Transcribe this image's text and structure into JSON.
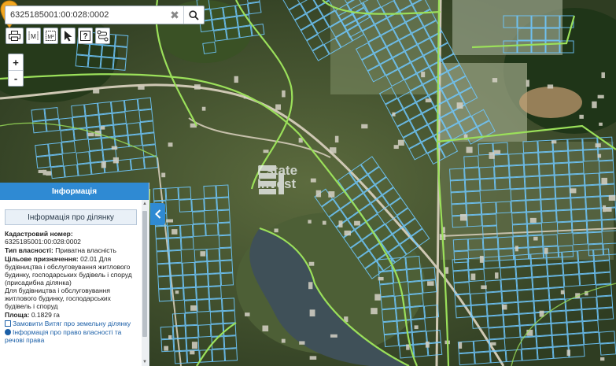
{
  "search": {
    "value": "6325185001:00:028:0002",
    "placeholder": ""
  },
  "toolbar": {
    "tools": [
      {
        "icon": "printer-icon"
      },
      {
        "icon": "measure-distance-icon",
        "label": "M"
      },
      {
        "icon": "measure-area-icon",
        "label": "M²"
      },
      {
        "icon": "cursor-icon"
      },
      {
        "icon": "help-icon",
        "label": "?"
      },
      {
        "icon": "route-icon"
      }
    ]
  },
  "zoom": {
    "in_label": "+",
    "out_label": "-"
  },
  "watermark": {
    "line1": "Estate",
    "line2": "Invest"
  },
  "panel": {
    "header": "Інформація",
    "section_title": "Інформація про ділянку",
    "cadastral_label": "Кадастровий номер:",
    "cadastral_value": "6325185001:00:028:0002",
    "ownership_label": "Тип власності:",
    "ownership_value": "Приватна власність",
    "purpose_label": "Цільове призначення:",
    "purpose_value": "02.01 Для будівництва і обслуговування житлового будинку, господарських будівель і споруд (присадибна ділянка)",
    "purpose_extra": "Для будівництва і обслуговування житлового будинку, господарських будівель і споруд",
    "area_label": "Площа:",
    "area_value": "0.1829 га",
    "link_extract": "Замовити Витяг про земельну ділянку",
    "link_rights": "Інформація про право власності та речові права"
  },
  "colors": {
    "accent": "#2f8ad3",
    "parcel_outline": "#6fc8ff",
    "boundary": "#9be05a",
    "pin": "#f3a71f"
  }
}
